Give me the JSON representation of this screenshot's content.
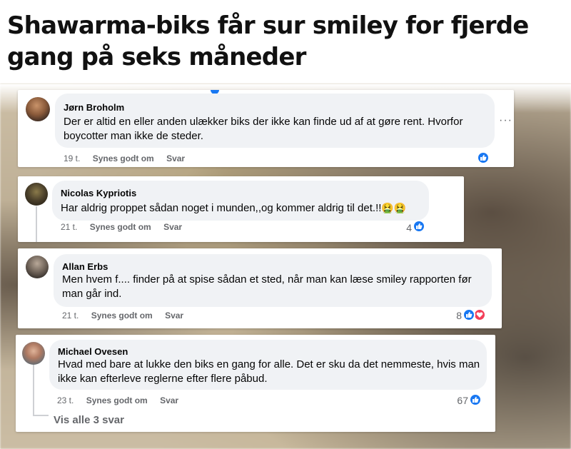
{
  "headline": "Shawarma-biks får sur smiley for fjerde gang på seks måneder",
  "colors": {
    "like_blue": "#1877f2",
    "love_red": "#f33e58",
    "bubble_gray": "#f0f2f5",
    "meta_gray": "#65676b"
  },
  "comments": [
    {
      "author": "Jørn Broholm",
      "text": "Der er altid en eller anden ulækker biks der ikke kan finde ud af at gøre rent. Hvorfor boycotter man ikke de steder.",
      "time": "19 t.",
      "like_label": "Synes godt om",
      "reply_label": "Svar",
      "reaction_count": "",
      "reactions": [
        "like-icon"
      ]
    },
    {
      "author": "Nicolas Kypriotis",
      "text": "Har aldrig proppet sådan noget i munden,,og kommer aldrig til det.!!",
      "emoji": "🤮🤮",
      "time": "21 t.",
      "like_label": "Synes godt om",
      "reply_label": "Svar",
      "reaction_count": "4",
      "reactions": [
        "like-icon"
      ]
    },
    {
      "author": "Allan Erbs",
      "text": "Men hvem f.... finder på at spise sådan et sted, når man kan læse smiley rapporten før man går ind.",
      "time": "21 t.",
      "like_label": "Synes godt om",
      "reply_label": "Svar",
      "reaction_count": "8",
      "reactions": [
        "like-icon",
        "heart-icon"
      ]
    },
    {
      "author": "Michael Ovesen",
      "text": "Hvad med bare at lukke den biks en gang for alle. Det er sku da det nemmeste, hvis man ikke kan efterleve reglerne efter flere påbud.",
      "time": "23 t.",
      "like_label": "Synes godt om",
      "reply_label": "Svar",
      "reaction_count": "67",
      "reactions": [
        "like-icon"
      ]
    }
  ],
  "view_all_replies": "Vis alle 3 svar"
}
